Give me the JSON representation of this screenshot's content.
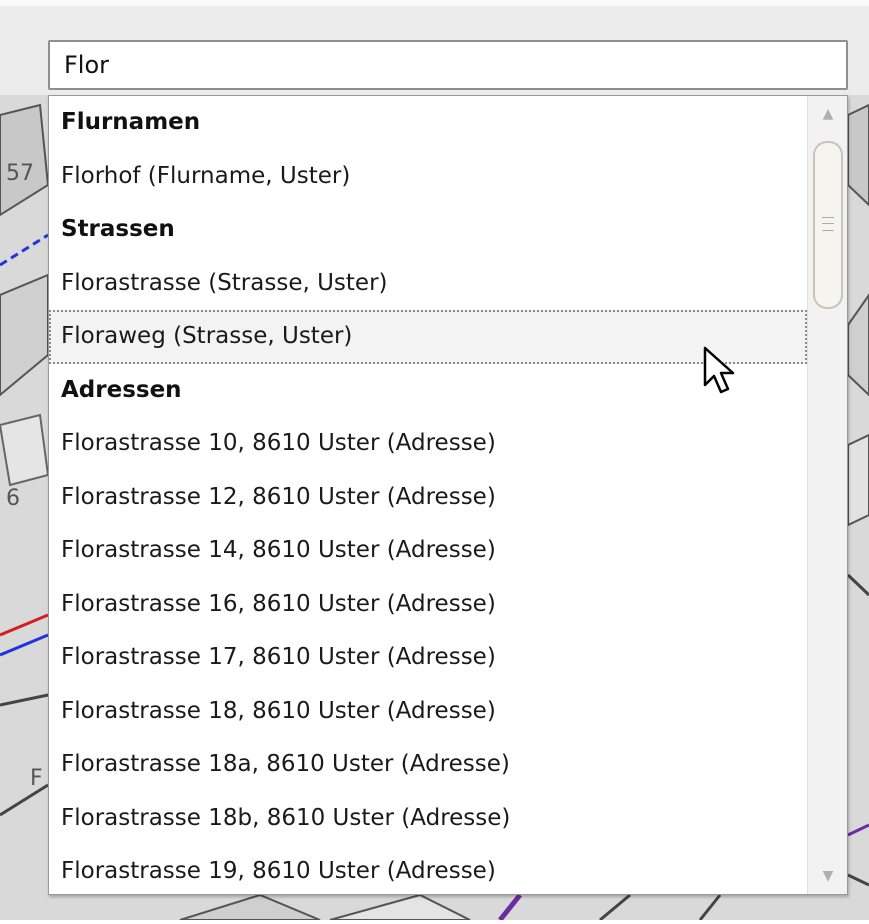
{
  "search": {
    "value": "Flor"
  },
  "dropdown": {
    "rows": [
      {
        "label": "Flurnamen",
        "kind": "header"
      },
      {
        "label": "Florhof (Flurname, Uster)",
        "kind": "item"
      },
      {
        "label": "Strassen",
        "kind": "header"
      },
      {
        "label": "Florastrasse (Strasse, Uster)",
        "kind": "item"
      },
      {
        "label": "Floraweg (Strasse, Uster)",
        "kind": "item",
        "hovered": true
      },
      {
        "label": "Adressen",
        "kind": "header"
      },
      {
        "label": "Florastrasse 10, 8610 Uster (Adresse)",
        "kind": "item"
      },
      {
        "label": "Florastrasse 12, 8610 Uster (Adresse)",
        "kind": "item"
      },
      {
        "label": "Florastrasse 14, 8610 Uster (Adresse)",
        "kind": "item"
      },
      {
        "label": "Florastrasse 16, 8610 Uster (Adresse)",
        "kind": "item"
      },
      {
        "label": "Florastrasse 17, 8610 Uster (Adresse)",
        "kind": "item"
      },
      {
        "label": "Florastrasse 18, 8610 Uster (Adresse)",
        "kind": "item"
      },
      {
        "label": "Florastrasse 18a, 8610 Uster (Adresse)",
        "kind": "item"
      },
      {
        "label": "Florastrasse 18b, 8610 Uster (Adresse)",
        "kind": "item"
      },
      {
        "label": "Florastrasse 19, 8610 Uster (Adresse)",
        "kind": "item"
      }
    ]
  },
  "map_labels": {
    "left_1": "57",
    "left_2": "6",
    "left_3": "F"
  },
  "colors": {
    "hover_background": "#f3f3f3",
    "map_background": "#dcdcdc"
  }
}
